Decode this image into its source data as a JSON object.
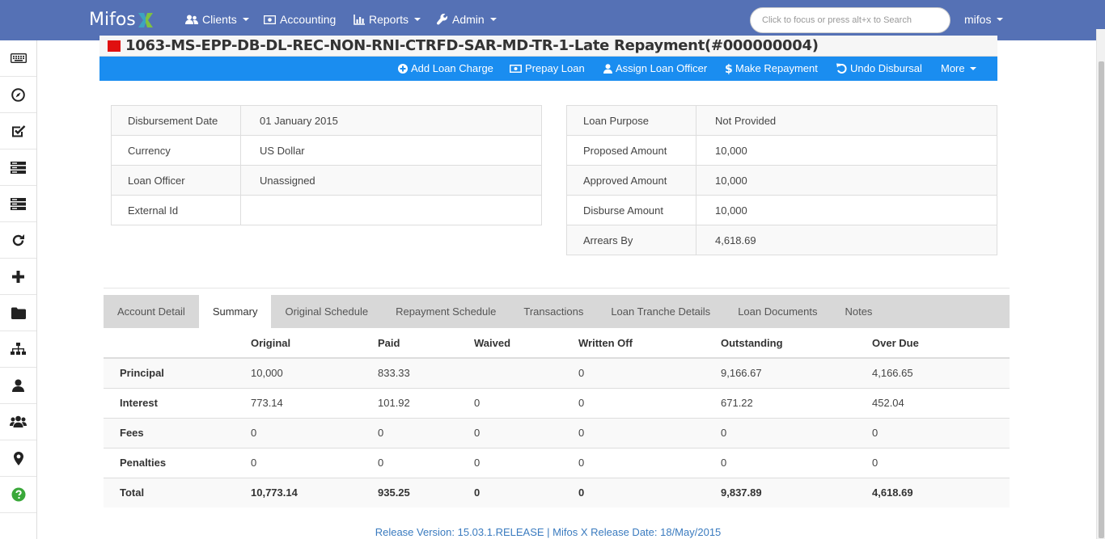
{
  "navbar": {
    "brand": "Mifos",
    "items": [
      {
        "label": "Clients",
        "icon": "users-icon",
        "dropdown": true
      },
      {
        "label": "Accounting",
        "icon": "money-icon",
        "dropdown": false
      },
      {
        "label": "Reports",
        "icon": "bar-chart-icon",
        "dropdown": true
      },
      {
        "label": "Admin",
        "icon": "wrench-icon",
        "dropdown": true
      }
    ],
    "search_placeholder": "Click to focus or press alt+x to Search",
    "user": "mifos"
  },
  "sidebar": {
    "icons": [
      "keyboard-icon",
      "compass-icon",
      "checkbox-icon",
      "server-icon",
      "server-icon",
      "refresh-icon",
      "plus-icon",
      "folder-icon",
      "sitemap-icon",
      "user-icon",
      "group-icon",
      "map-marker-icon",
      "help-icon"
    ]
  },
  "loan": {
    "title": "1063-MS-EPP-DB-DL-REC-NON-RNI-CTRFD-SAR-MD-TR-1-Late Repayment(#000000004)",
    "status_color": "#e01010"
  },
  "actions": [
    {
      "label": "Add Loan Charge",
      "icon": "plus-circle-icon"
    },
    {
      "label": "Prepay Loan",
      "icon": "money-icon"
    },
    {
      "label": "Assign Loan Officer",
      "icon": "user-icon"
    },
    {
      "label": "Make Repayment",
      "icon": "dollar-icon"
    },
    {
      "label": "Undo Disbursal",
      "icon": "undo-icon"
    },
    {
      "label": "More",
      "icon": "caret-down-icon"
    }
  ],
  "details_left": [
    {
      "label": "Disbursement Date",
      "value": "01 January 2015"
    },
    {
      "label": "Currency",
      "value": "US Dollar"
    },
    {
      "label": "Loan Officer",
      "value": "Unassigned"
    },
    {
      "label": "External Id",
      "value": ""
    }
  ],
  "details_right": [
    {
      "label": "Loan Purpose",
      "value": "Not Provided"
    },
    {
      "label": "Proposed Amount",
      "value": "10,000"
    },
    {
      "label": "Approved Amount",
      "value": "10,000"
    },
    {
      "label": "Disburse Amount",
      "value": "10,000"
    },
    {
      "label": "Arrears By",
      "value": "4,618.69"
    }
  ],
  "tabs": [
    "Account Detail",
    "Summary",
    "Original Schedule",
    "Repayment Schedule",
    "Transactions",
    "Loan Tranche Details",
    "Loan Documents",
    "Notes"
  ],
  "active_tab": "Summary",
  "summary": {
    "columns": [
      "",
      "Original",
      "Paid",
      "Waived",
      "Written Off",
      "Outstanding",
      "Over Due"
    ],
    "rows": [
      [
        "Principal",
        "10,000",
        "833.33",
        "",
        "0",
        "9,166.67",
        "4,166.65"
      ],
      [
        "Interest",
        "773.14",
        "101.92",
        "0",
        "0",
        "671.22",
        "452.04"
      ],
      [
        "Fees",
        "0",
        "0",
        "0",
        "0",
        "0",
        "0"
      ],
      [
        "Penalties",
        "0",
        "0",
        "0",
        "0",
        "0",
        "0"
      ],
      [
        "Total",
        "10,773.14",
        "935.25",
        "0",
        "0",
        "9,837.89",
        "4,618.69"
      ]
    ]
  },
  "footer": "Release Version: 15.03.1.RELEASE | Mifos X Release Date: 18/May/2015"
}
